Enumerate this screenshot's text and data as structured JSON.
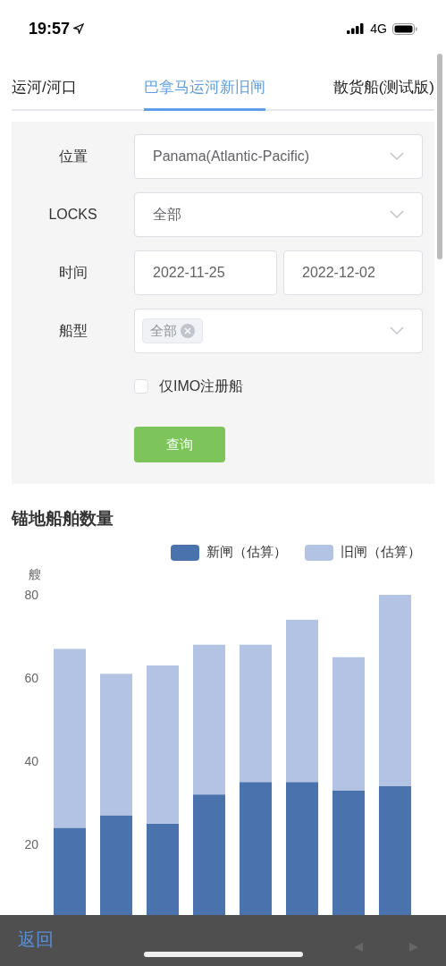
{
  "status_bar": {
    "time": "19:57",
    "network": "4G"
  },
  "tabs": [
    {
      "label": "运河/河口",
      "selected": false
    },
    {
      "label": "巴拿马运河新旧闸",
      "selected": true
    },
    {
      "label": "散货船(测试版)",
      "selected": false
    }
  ],
  "form": {
    "location": {
      "label": "位置",
      "value": "Panama(Atlantic-Pacific)"
    },
    "locks": {
      "label": "LOCKS",
      "value": "全部"
    },
    "time": {
      "label": "时间",
      "start": "2022-11-25",
      "end": "2022-12-02"
    },
    "ship_type": {
      "label": "船型",
      "tags": [
        "全部"
      ]
    },
    "imo_only": {
      "label": "仅IMO注册船",
      "checked": false
    },
    "query_button": "查询"
  },
  "chart": {
    "title": "锚地船舶数量",
    "chart_data": {
      "type": "bar",
      "stacked": true,
      "ylabel": "艘",
      "yticks": [
        20,
        40,
        60,
        80
      ],
      "ylim": [
        0,
        80
      ],
      "series": [
        {
          "name": "新闸（估算）",
          "color": "#4a73ad",
          "values": [
            24,
            27,
            25,
            32,
            35,
            35,
            33,
            34
          ]
        },
        {
          "name": "旧闸（估算）",
          "color": "#b3c3e4",
          "values": [
            43,
            34,
            38,
            36,
            33,
            39,
            32,
            46
          ]
        }
      ]
    }
  },
  "bottom_bar": {
    "back": "返回"
  }
}
